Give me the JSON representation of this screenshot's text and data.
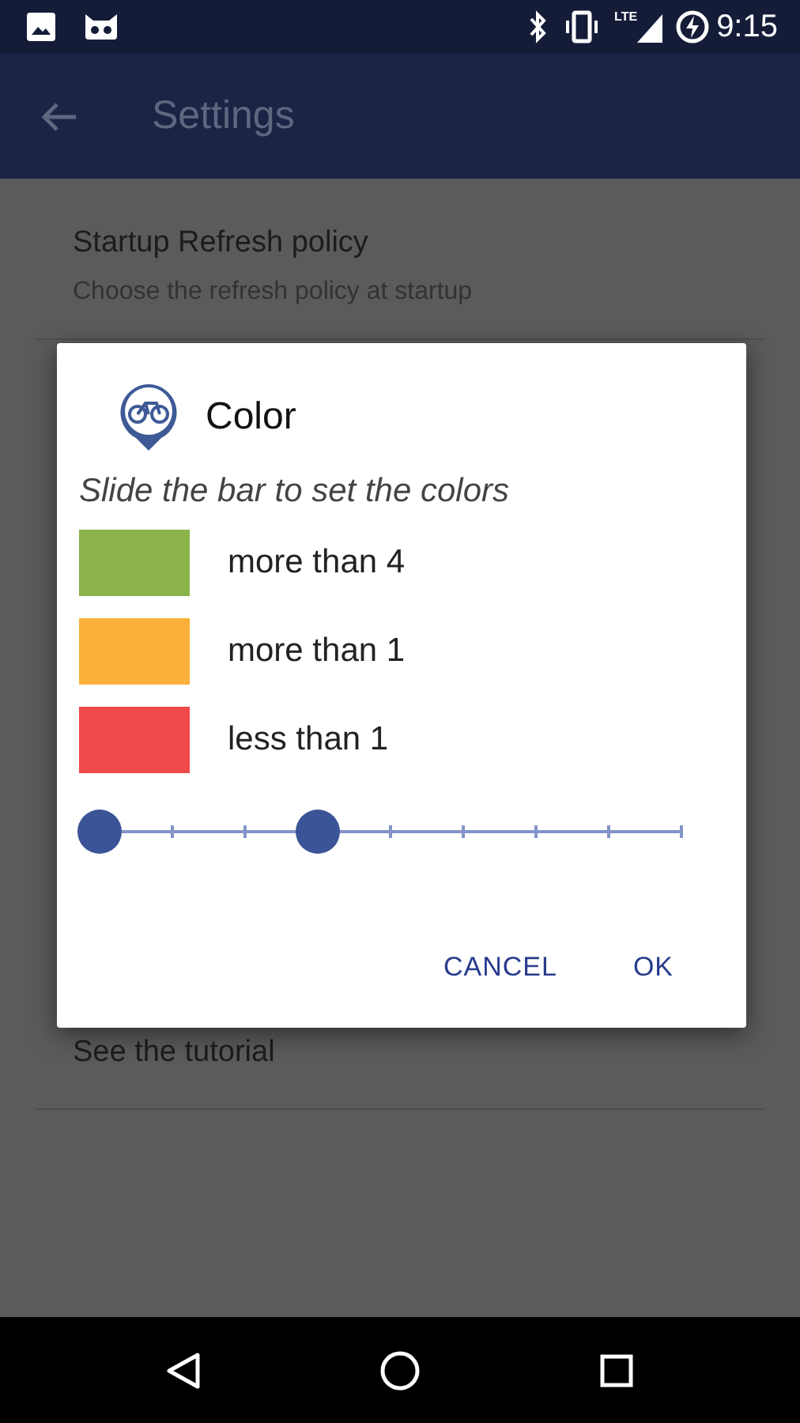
{
  "status_bar": {
    "network": "LTE",
    "time": "9:15"
  },
  "toolbar": {
    "title": "Settings"
  },
  "settings": [
    {
      "title": "Startup Refresh policy",
      "subtitle": "Choose the refresh policy at startup"
    },
    {
      "title": "See the tutorial"
    }
  ],
  "dialog": {
    "title": "Color",
    "message": "Slide the bar to set the colors",
    "legend": [
      {
        "label": "more than 4",
        "color": "#8ab34a"
      },
      {
        "label": "more than 1",
        "color": "#fbb03b"
      },
      {
        "label": "less than 1",
        "color": "#f0494a"
      }
    ],
    "slider": {
      "thumbs": [
        {
          "level": 0
        },
        {
          "level": 0.375
        }
      ]
    },
    "buttons": [
      "CANCEL",
      "OK"
    ]
  }
}
